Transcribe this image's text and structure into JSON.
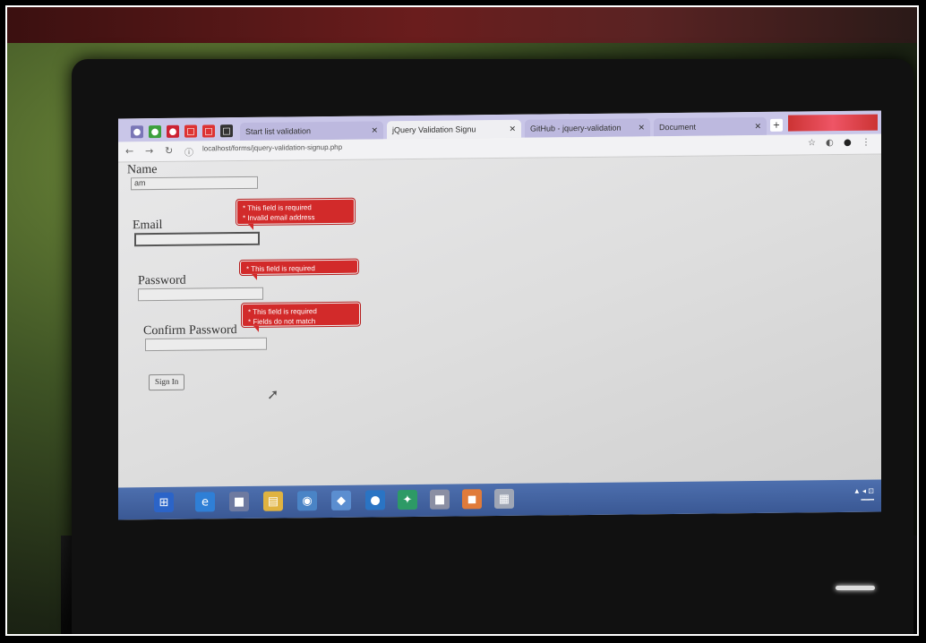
{
  "browser": {
    "tabs": [
      {
        "label": "Start list validation",
        "active": false
      },
      {
        "label": "jQuery Validation Signu",
        "active": true
      },
      {
        "label": "GitHub - jquery-validation",
        "active": false
      },
      {
        "label": "Document",
        "active": false
      }
    ],
    "address": "localhost/forms/jquery-validation-signup.php"
  },
  "form": {
    "name_label": "Name",
    "name_value": "am",
    "email_label": "Email",
    "password_label": "Password",
    "confirm_label": "Confirm Password",
    "submit_label": "Sign In",
    "tooltips": {
      "email": [
        "* This field is required",
        "* Invalid email address"
      ],
      "password": [
        "* This field is required"
      ],
      "confirm": [
        "* This field is required",
        "* Fields do not match"
      ]
    }
  },
  "colors": {
    "error": "#d22a2a",
    "taskbar": "#3f5e9c"
  },
  "icons": [
    "back-icon",
    "forward-icon",
    "reload-icon",
    "info-icon",
    "star-icon",
    "profile-icon",
    "start-icon",
    "ie-icon",
    "folder-icon",
    "chrome-icon",
    "cursor-icon"
  ]
}
